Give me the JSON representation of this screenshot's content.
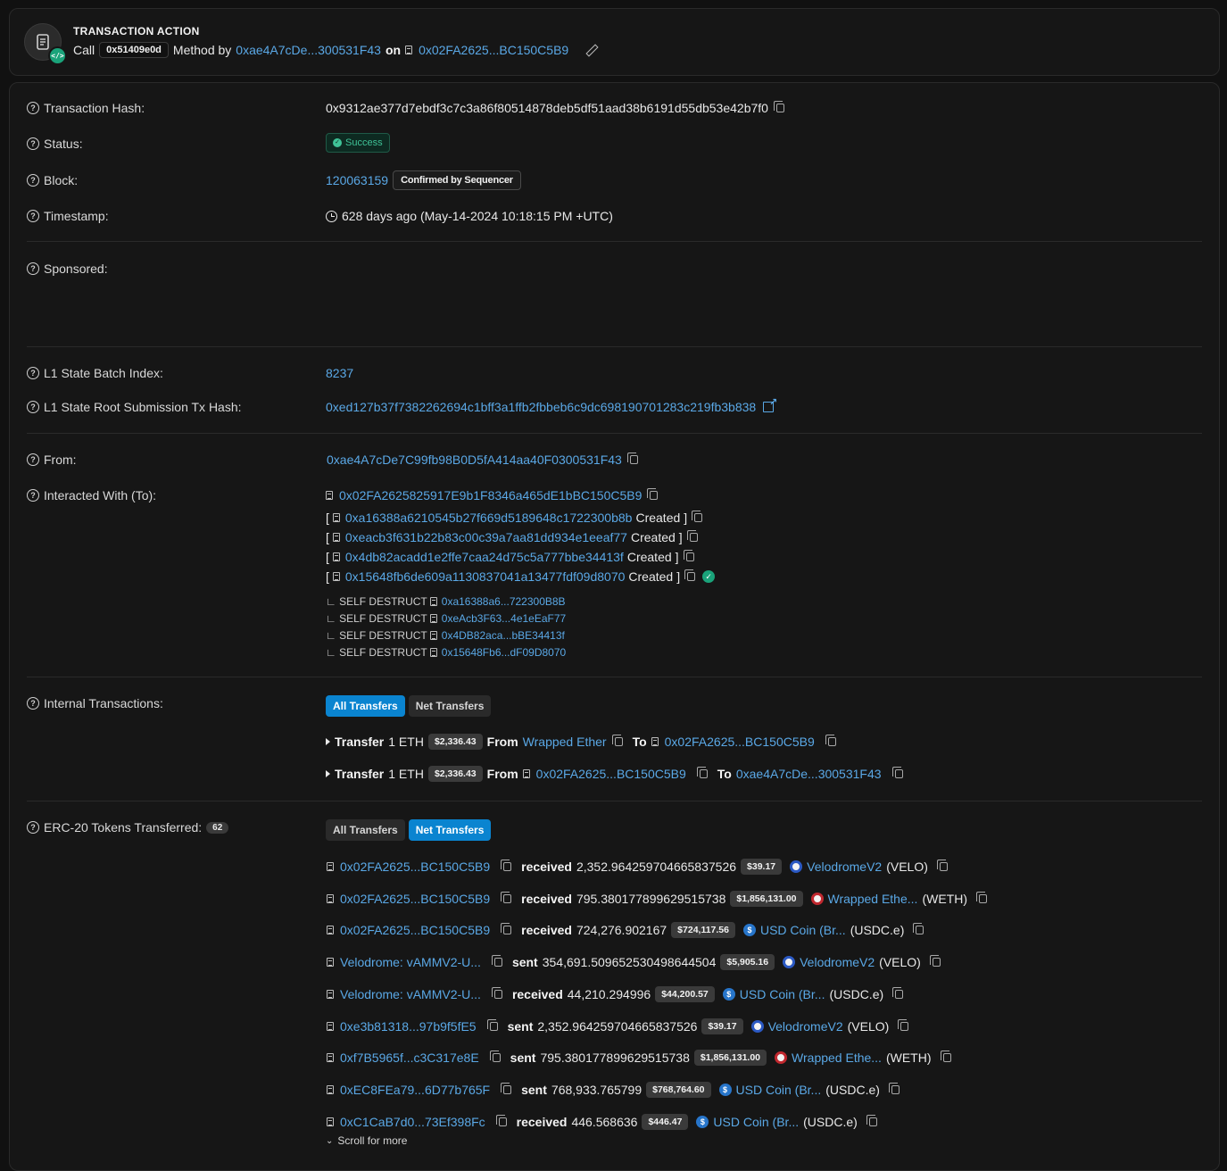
{
  "action": {
    "title": "TRANSACTION ACTION",
    "call_label": "Call",
    "method_id": "0x51409e0d",
    "method_by_label": "Method by",
    "method_by_address": "0xae4A7cDe...300531F43",
    "on_label": "on",
    "on_address": "0x02FA2625...BC150C5B9"
  },
  "labels": {
    "tx_hash": "Transaction Hash:",
    "status": "Status:",
    "block": "Block:",
    "timestamp": "Timestamp:",
    "sponsored": "Sponsored:",
    "l1_batch": "L1 State Batch Index:",
    "l1_root": "L1 State Root Submission Tx Hash:",
    "from": "From:",
    "to": "Interacted With (To):",
    "internal": "Internal Transactions:",
    "erc20": "ERC-20 Tokens Transferred:"
  },
  "values": {
    "tx_hash": "0x9312ae377d7ebdf3c7c3a86f80514878deb5df51aad38b6191d55db53e42b7f0",
    "status": "Success",
    "block_number": "120063159",
    "block_confirm": "Confirmed by Sequencer",
    "timestamp": "628 days ago (May-14-2024 10:18:15 PM +UTC)",
    "l1_batch": "8237",
    "l1_root": "0xed127b37f7382262694c1bff3a1ffb2fbbeb6c9dc698190701283c219fb3b838",
    "from": "0xae4A7cDe7C99fb98B0D5fA414aa40F0300531F43",
    "to_main": "0x02FA2625825917E9b1F8346a465dE1bBC150C5B9"
  },
  "created": [
    {
      "open": "[",
      "address": "0xa16388a6210545b27f669d5189648c1722300b8b",
      "word": "Created",
      "close": "]"
    },
    {
      "open": "[",
      "address": "0xeacb3f631b22b83c00c39a7aa81dd934e1eeaf77",
      "word": "Created",
      "close": "]"
    },
    {
      "open": "[",
      "address": "0x4db82acadd1e2ffe7caa24d75c5a777bbe34413f",
      "word": "Created",
      "close": "]"
    },
    {
      "open": "[",
      "address": "0x15648fb6de609a1130837041a13477fdf09d8070",
      "word": "Created",
      "close": "]"
    }
  ],
  "self_destruct": [
    {
      "prefix": "∟ SELF DESTRUCT",
      "address": "0xa16388a6...722300B8B"
    },
    {
      "prefix": "∟ SELF DESTRUCT",
      "address": "0xeAcb3F63...4e1eEaF77"
    },
    {
      "prefix": "∟ SELF DESTRUCT",
      "address": "0x4DB82aca...bBE34413f"
    },
    {
      "prefix": "∟ SELF DESTRUCT",
      "address": "0x15648Fb6...dF09D8070"
    }
  ],
  "internal_tabs": [
    "All Transfers",
    "Net Transfers"
  ],
  "internal": [
    {
      "word": "Transfer",
      "amount": "1 ETH",
      "usd": "$2,336.43",
      "from_label": "From",
      "from": "Wrapped Ether",
      "to_label": "To",
      "to": "0x02FA2625...BC150C5B9"
    },
    {
      "word": "Transfer",
      "amount": "1 ETH",
      "usd": "$2,336.43",
      "from_label": "From",
      "from": "0x02FA2625...BC150C5B9",
      "to_label": "To",
      "to": "0xae4A7cDe...300531F43"
    }
  ],
  "erc20_count": "62",
  "erc20_tabs": [
    "All Transfers",
    "Net Transfers"
  ],
  "erc20": [
    {
      "address": "0x02FA2625...BC150C5B9",
      "dir": "received",
      "amount": "2,352.964259704665837526",
      "usd": "$39.17",
      "icon": "velo",
      "token": "VelodromeV2",
      "symbol": "(VELO)"
    },
    {
      "address": "0x02FA2625...BC150C5B9",
      "dir": "received",
      "amount": "795.380177899629515738",
      "usd": "$1,856,131.00",
      "icon": "weth",
      "token": "Wrapped Ethe...",
      "symbol": "(WETH)"
    },
    {
      "address": "0x02FA2625...BC150C5B9",
      "dir": "received",
      "amount": "724,276.902167",
      "usd": "$724,117.56",
      "icon": "usdc",
      "token": "USD Coin (Br...",
      "symbol": "(USDC.e)"
    },
    {
      "address": "Velodrome: vAMMV2-U...",
      "dir": "sent",
      "amount": "354,691.509652530498644504",
      "usd": "$5,905.16",
      "icon": "velo",
      "token": "VelodromeV2",
      "symbol": "(VELO)"
    },
    {
      "address": "Velodrome: vAMMV2-U...",
      "dir": "received",
      "amount": "44,210.294996",
      "usd": "$44,200.57",
      "icon": "usdc",
      "token": "USD Coin (Br...",
      "symbol": "(USDC.e)"
    },
    {
      "address": "0xe3b81318...97b9f5fE5",
      "dir": "sent",
      "amount": "2,352.964259704665837526",
      "usd": "$39.17",
      "icon": "velo",
      "token": "VelodromeV2",
      "symbol": "(VELO)"
    },
    {
      "address": "0xf7B5965f...c3C317e8E",
      "dir": "sent",
      "amount": "795.380177899629515738",
      "usd": "$1,856,131.00",
      "icon": "weth",
      "token": "Wrapped Ethe...",
      "symbol": "(WETH)"
    },
    {
      "address": "0xEC8FEa79...6D77b765F",
      "dir": "sent",
      "amount": "768,933.765799",
      "usd": "$768,764.60",
      "icon": "usdc",
      "token": "USD Coin (Br...",
      "symbol": "(USDC.e)"
    },
    {
      "address": "0xC1CaB7d0...73Ef398Fc",
      "dir": "received",
      "amount": "446.568636",
      "usd": "$446.47",
      "icon": "usdc",
      "token": "USD Coin (Br...",
      "symbol": "(USDC.e)"
    }
  ],
  "scroll_more": "Scroll for more"
}
